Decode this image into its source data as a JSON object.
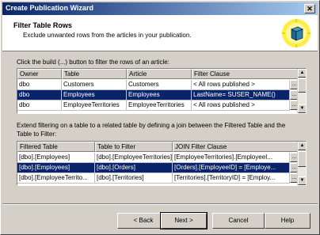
{
  "window": {
    "title": "Create Publication Wizard",
    "close_glyph": "✕"
  },
  "header": {
    "title": "Filter Table Rows",
    "subtitle": "Exclude unwanted rows from the articles in your publication."
  },
  "articles": {
    "instruction": "Click the build (...) button to filter the rows of an article:",
    "columns": [
      "Owner",
      "Table",
      "Article",
      "Filter Clause"
    ],
    "rows": [
      {
        "owner": "dbo",
        "table": "Customers",
        "article": "Customers",
        "filter": "< All rows published >",
        "selected": false
      },
      {
        "owner": "dbo",
        "table": "Employees",
        "article": "Employees",
        "filter": "LastName= SUSER_NAME()",
        "selected": true
      },
      {
        "owner": "dbo",
        "table": "EmployeeTerritories",
        "article": "EmployeeTerritories",
        "filter": "< All rows published >",
        "selected": false
      }
    ],
    "build_label": "..."
  },
  "joins": {
    "instruction_line1": "Extend filtering on a table to a related table by defining a join between the Filtered Table and the",
    "instruction_line2": "Table to Filter:",
    "columns": [
      "Filtered Table",
      "Table to Filter",
      "JOIN Filter Clause"
    ],
    "rows": [
      {
        "filtered": "[dbo].[Employees]",
        "to_filter": "[dbo].[EmployeeTerritories]",
        "clause": "[EmployeeTerritories].[EmployeeI...",
        "selected": false
      },
      {
        "filtered": "[dbo].[Employees]",
        "to_filter": "[dbo].[Orders]",
        "clause": "[Orders].[EmployeeID] = [Employe...",
        "selected": true
      },
      {
        "filtered": "[dbo].[EmployeeTerrito...",
        "to_filter": "[dbo].[Territories]",
        "clause": "[Territories].[TerritoryID] = [Employ...",
        "selected": false
      }
    ],
    "build_label": "..."
  },
  "buttons": {
    "back": "< Back",
    "next": "Next >",
    "cancel": "Cancel",
    "help": "Help"
  },
  "icons": {
    "close": "close-icon",
    "wizard": "wizard-cube-icon",
    "scroll_up": "scroll-up-icon",
    "scroll_down": "scroll-down-icon"
  },
  "colors": {
    "title_gradient_start": "#0a246a",
    "selection": "#0a246a",
    "face": "#d4d0c8"
  }
}
